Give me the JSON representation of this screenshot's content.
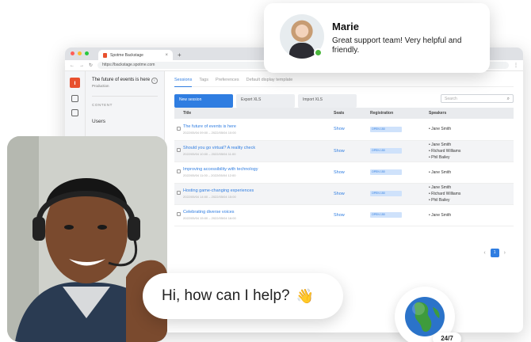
{
  "colors": {
    "accent": "#2f7de1",
    "brand": "#e8502e",
    "online": "#4bb73c"
  },
  "browser": {
    "tab_title": "Spotme Backstage",
    "url": "https://backstage.spotme.com",
    "new_tab": "+",
    "tab_close": "×"
  },
  "sidebar": {
    "brand_glyph": "ı",
    "event_title": "The future of events is here",
    "event_sub": "Production",
    "section_label": "CONTENT",
    "link": "Users"
  },
  "tabs": [
    {
      "label": "Sessions",
      "active": true
    },
    {
      "label": "Tags",
      "active": false
    },
    {
      "label": "Preferences",
      "active": false
    },
    {
      "label": "Default display template",
      "active": false
    }
  ],
  "toolbar": {
    "new_session": "New session",
    "export": "Export XLS",
    "import": "Import XLS",
    "search_placeholder": "Search"
  },
  "table": {
    "headers": [
      "Title",
      "Seats",
      "Registration",
      "Speakers"
    ],
    "rows": [
      {
        "title": "The future of events is here",
        "sub": "2022/05/04 09:00 – 2022/05/04 10:00",
        "seats": "Show",
        "registration": "OPEN 150",
        "speakers": [
          "Jane Smith"
        ]
      },
      {
        "title": "Should you go virtual? A reality check",
        "sub": "2022/05/04 10:00 – 2022/05/04 11:00",
        "seats": "Show",
        "registration": "OPEN 150",
        "speakers": [
          "Jane Smith",
          "Richard Williams",
          "Phil Bailey"
        ]
      },
      {
        "title": "Improving accessibility with technology",
        "sub": "2022/05/04 11:00 – 2022/05/04 12:00",
        "seats": "Show",
        "registration": "OPEN 150",
        "speakers": [
          "Jane Smith"
        ]
      },
      {
        "title": "Hosting game-changing experiences",
        "sub": "2022/05/04 14:00 – 2022/05/04 15:00",
        "seats": "Show",
        "registration": "OPEN 150",
        "speakers": [
          "Jane Smith",
          "Richard Williams",
          "Phil Bailey"
        ]
      },
      {
        "title": "Celebrating diverse voices",
        "sub": "2022/05/04 15:00 – 2022/05/04 16:00",
        "seats": "Show",
        "registration": "OPEN 150",
        "speakers": [
          "Jane Smith"
        ]
      }
    ]
  },
  "pager": {
    "prev": "‹",
    "current": "1",
    "next": "›"
  },
  "review": {
    "name": "Marie",
    "text": "Great support team! Very helpful and friendly."
  },
  "chat": {
    "text": "Hi, how can I help?",
    "emoji": "👋"
  },
  "badge": "24/7"
}
